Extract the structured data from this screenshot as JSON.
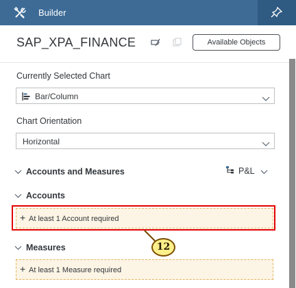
{
  "header": {
    "title": "Builder",
    "left_icon": "tools-icon",
    "right_icon": "pin-icon"
  },
  "model": {
    "name": "SAP_XPA_FINANCE",
    "available_objects_label": "Available Objects"
  },
  "chart_selection": {
    "label": "Currently Selected Chart",
    "value": "Bar/Column",
    "icon": "bar-chart-icon"
  },
  "orientation": {
    "label": "Chart Orientation",
    "value": "Horizontal"
  },
  "accounts_measures": {
    "title": "Accounts and Measures",
    "dropdown_value": "P&L"
  },
  "accounts": {
    "title": "Accounts",
    "placeholder": "At least 1 Account required"
  },
  "measures": {
    "title": "Measures",
    "placeholder": "At least 1 Measure required"
  },
  "annotation": {
    "callout_number": "12",
    "highlight_color": "#e10000"
  },
  "colors": {
    "header_bg": "#3d6b96",
    "dropzone_bg": "#fcf4e5",
    "dropzone_border": "#e2b45a"
  }
}
